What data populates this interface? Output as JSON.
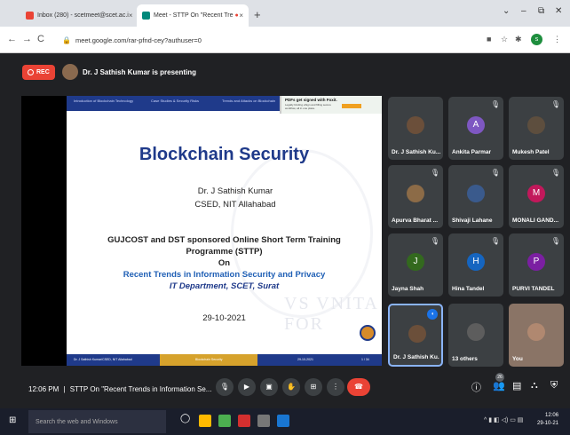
{
  "browser": {
    "tabs": [
      {
        "label": "Inbox (280) - scetmeet@scet.ac.i",
        "close": "×"
      },
      {
        "label": "Meet - STTP On \"Recent Tre",
        "close": "×"
      }
    ],
    "new_tab": "+",
    "window_controls": [
      "⌄",
      "–",
      "⧉",
      "✕"
    ],
    "url": "meet.google.com/rar-pfnd-cey?authuser=0",
    "profile_initial": "s"
  },
  "meet": {
    "rec_label": "REC",
    "presenting_text": "Dr. J Sathish Kumar is presenting",
    "slide": {
      "nav": [
        "Introduction of Blockchain Technology",
        "Case Studies & Security Risks",
        "Trends and Attacks on Blockchain"
      ],
      "ad_title": "PDFs get signed with Foxit.",
      "ad_sub": "Legally binding eSign and filling secure workflow, all in one place.",
      "title": "Blockchain Security",
      "name": "Dr. J Sathish Kumar",
      "dept": "CSED, NIT Allahabad",
      "line1": "GUJCOST and DST sponsored Online Short Term Training",
      "line2": "Programme (STTP)",
      "line3": "On",
      "line4": "Recent Trends in Information Security and Privacy",
      "line5": "IT Department, SCET, Surat",
      "date": "29-10-2021",
      "watermark": "VS VNITA FOR",
      "footer_left": "Dr. J Sathish Kumar/CSED, NIT Allahabad",
      "footer_mid": "Blockchain Security",
      "footer_date": "29-10-2021",
      "footer_page": "1 / 34"
    },
    "participants": [
      {
        "name": "Dr. J Sathish Ku...",
        "initial": "",
        "color": "#6b4f3a",
        "muted": false
      },
      {
        "name": "Ankita Parmar",
        "initial": "A",
        "color": "#7e57c2",
        "muted": true
      },
      {
        "name": "Mukesh Patel",
        "initial": "",
        "color": "#5d4e3e",
        "muted": true
      },
      {
        "name": "Apurva Bharat ...",
        "initial": "",
        "color": "#8c6b47",
        "muted": true
      },
      {
        "name": "Shivaji Lahane",
        "initial": "",
        "color": "#3a5a8c",
        "muted": true
      },
      {
        "name": "MONALI GAND...",
        "initial": "M",
        "color": "#c2185b",
        "muted": true
      },
      {
        "name": "Jayna Shah",
        "initial": "J",
        "color": "#33691e",
        "muted": true
      },
      {
        "name": "Hina Tandel",
        "initial": "H",
        "color": "#1565c0",
        "muted": true
      },
      {
        "name": "PURVI TANDEL",
        "initial": "P",
        "color": "#7b1fa2",
        "muted": true
      },
      {
        "name": "Dr. J Sathish Ku...",
        "initial": "",
        "color": "#6b4f3a",
        "muted": false,
        "active": true
      },
      {
        "name": "13 others",
        "initial": "",
        "color": "#5d5d5d",
        "muted": false
      },
      {
        "name": "You",
        "initial": "",
        "color": "#b08870",
        "muted": false
      }
    ],
    "bottom": {
      "time": "12:06 PM",
      "separator": "|",
      "meeting_title": "STTP On \"Recent Trends in Information Se...",
      "participant_count": "26"
    }
  },
  "taskbar": {
    "search_placeholder": "Search the web and Windows",
    "time": "12:06",
    "date": "29-10-21"
  }
}
